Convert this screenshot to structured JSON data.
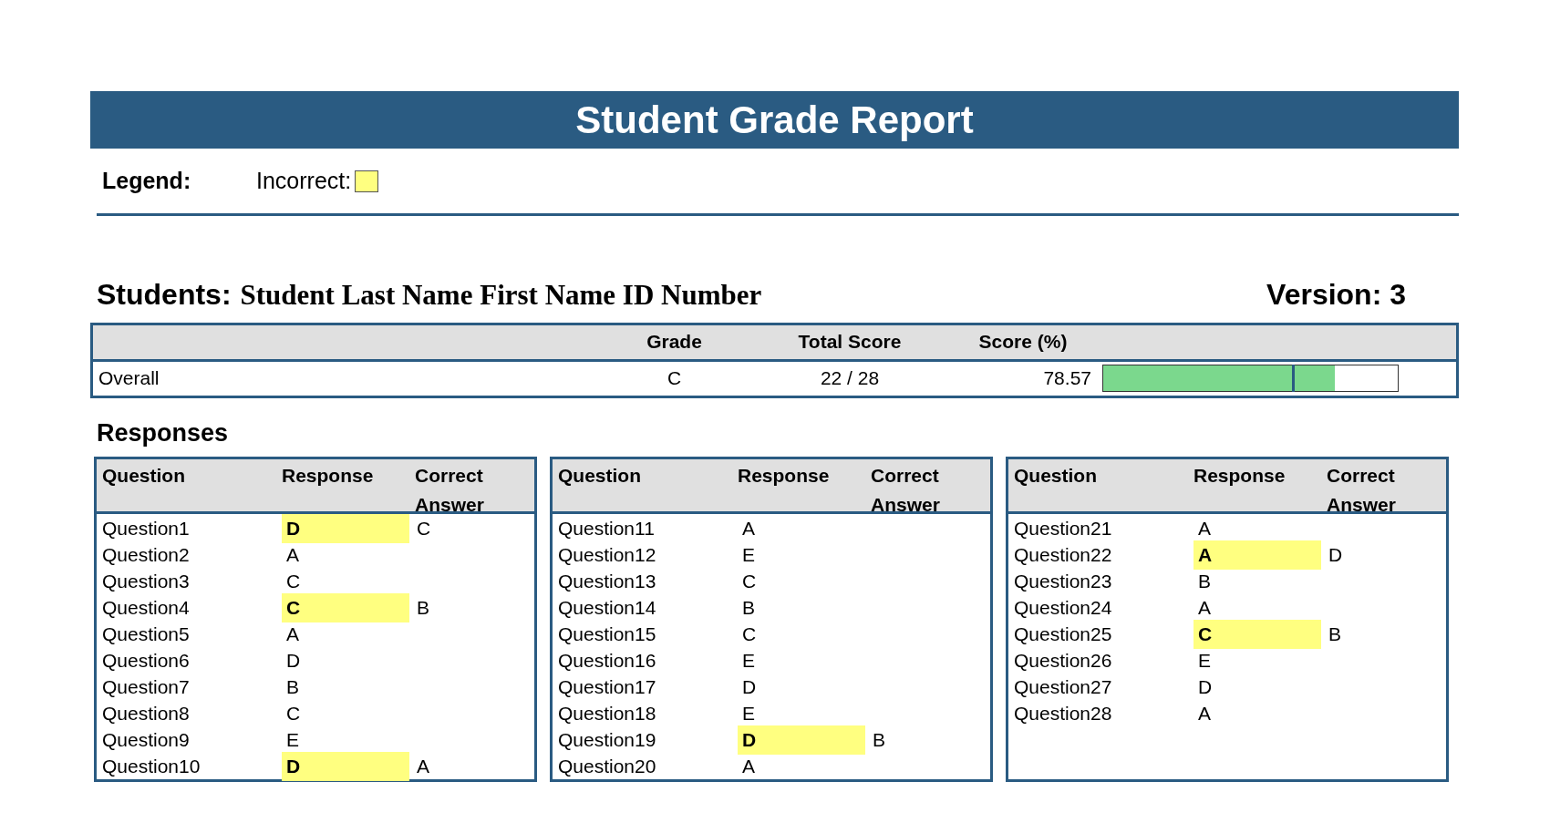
{
  "title": "Student Grade Report",
  "legend": {
    "label": "Legend:",
    "items": [
      {
        "label": "Incorrect:",
        "color": "#ffff80"
      }
    ]
  },
  "students": {
    "label": "Students:",
    "value": "Student Last Name First Name ID Number"
  },
  "version": {
    "label": "Version:",
    "value": "3"
  },
  "summary": {
    "columns": [
      "",
      "Grade",
      "Total Score",
      "Score (%)"
    ],
    "row": {
      "label": "Overall",
      "grade": "C",
      "total_score": "22 / 28",
      "score_pct": "78.57",
      "level": 0.7857
    }
  },
  "responses_title": "Responses",
  "response_tables": [
    {
      "columns": [
        "Question",
        "Response",
        "Correct Answer"
      ],
      "rows": [
        {
          "question": "Question1",
          "response": "D",
          "correct": "C",
          "incorrect": true
        },
        {
          "question": "Question2",
          "response": "A",
          "incorrect": false
        },
        {
          "question": "Question3",
          "response": "C",
          "incorrect": false
        },
        {
          "question": "Question4",
          "response": "C",
          "correct": "B",
          "incorrect": true
        },
        {
          "question": "Question5",
          "response": "A",
          "incorrect": false
        },
        {
          "question": "Question6",
          "response": "D",
          "incorrect": false
        },
        {
          "question": "Question7",
          "response": "B",
          "incorrect": false
        },
        {
          "question": "Question8",
          "response": "C",
          "incorrect": false
        },
        {
          "question": "Question9",
          "response": "E",
          "incorrect": false
        },
        {
          "question": "Question10",
          "response": "D",
          "correct": "A",
          "incorrect": true
        }
      ]
    },
    {
      "columns": [
        "Question",
        "Response",
        "Correct Answer"
      ],
      "rows": [
        {
          "question": "Question11",
          "response": "A",
          "incorrect": false
        },
        {
          "question": "Question12",
          "response": "E",
          "incorrect": false
        },
        {
          "question": "Question13",
          "response": "C",
          "incorrect": false
        },
        {
          "question": "Question14",
          "response": "B",
          "incorrect": false
        },
        {
          "question": "Question15",
          "response": "C",
          "incorrect": false
        },
        {
          "question": "Question16",
          "response": "E",
          "incorrect": false
        },
        {
          "question": "Question17",
          "response": "D",
          "incorrect": false
        },
        {
          "question": "Question18",
          "response": "E",
          "incorrect": false
        },
        {
          "question": "Question19",
          "response": "D",
          "correct": "B",
          "incorrect": true
        },
        {
          "question": "Question20",
          "response": "A",
          "incorrect": false
        }
      ]
    },
    {
      "columns": [
        "Question",
        "Response",
        "Correct Answer"
      ],
      "rows": [
        {
          "question": "Question21",
          "response": "A",
          "incorrect": false
        },
        {
          "question": "Question22",
          "response": "A",
          "correct": "D",
          "incorrect": true
        },
        {
          "question": "Question23",
          "response": "B",
          "incorrect": false
        },
        {
          "question": "Question24",
          "response": "A",
          "incorrect": false
        },
        {
          "question": "Question25",
          "response": "C",
          "correct": "B",
          "incorrect": true
        },
        {
          "question": "Question26",
          "response": "E",
          "incorrect": false
        },
        {
          "question": "Question27",
          "response": "D",
          "incorrect": false
        },
        {
          "question": "Question28",
          "response": "A",
          "incorrect": false
        }
      ]
    }
  ]
}
